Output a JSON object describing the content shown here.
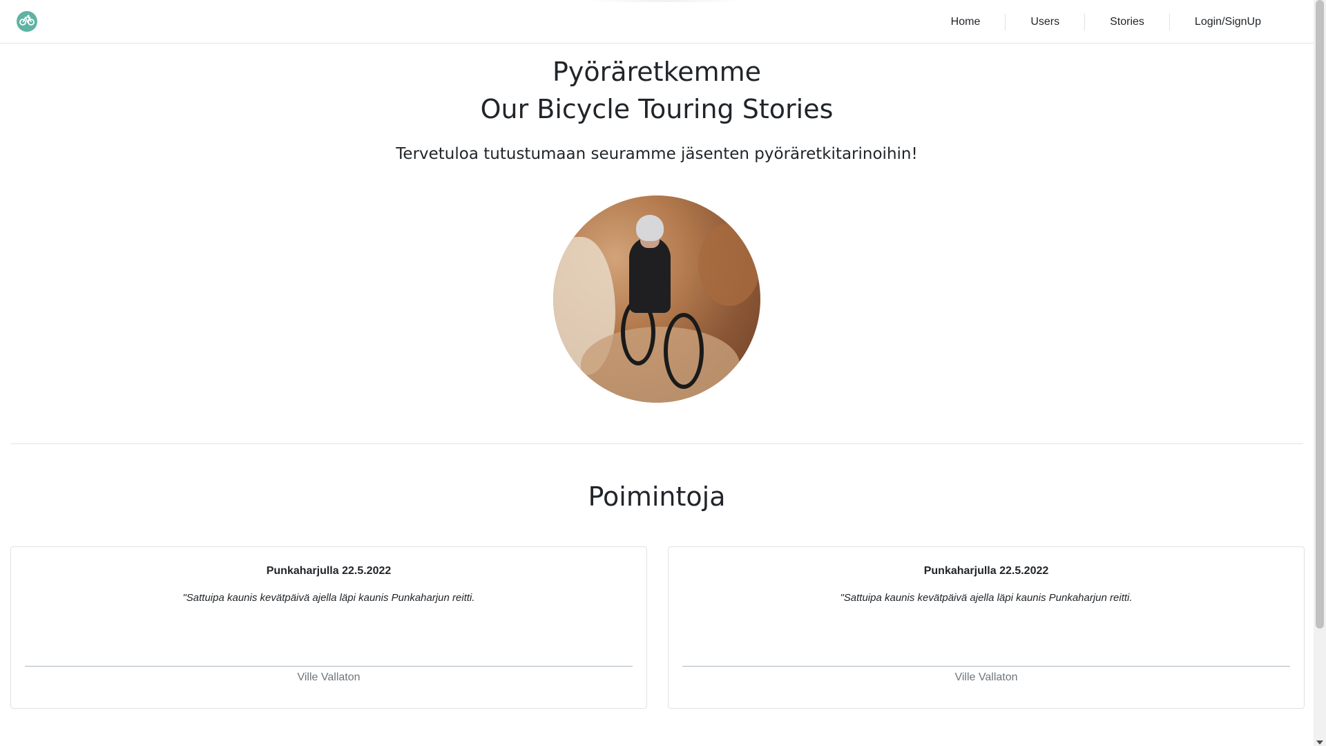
{
  "nav": {
    "logo_icon": "bicycle-icon",
    "links": [
      "Home",
      "Users",
      "Stories",
      "Login/SignUp"
    ]
  },
  "hero": {
    "title_line1": "Pyöräretkemme",
    "title_line2": "Our Bicycle Touring Stories",
    "subtitle": "Tervetuloa tutustumaan seuramme jäsenten pyöräretkitarinoihin!",
    "image_alt": "mountain biker riding on rocky desert trail"
  },
  "highlights": {
    "title": "Poimintoja",
    "cards": [
      {
        "title": "Punkaharjulla 22.5.2022",
        "quote": "\"Sattuipa kaunis kevätpäivä ajella läpi kaunis Punkaharjun reitti.",
        "author": "Ville Vallaton"
      },
      {
        "title": "Punkaharjulla 22.5.2022",
        "quote": "\"Sattuipa kaunis kevätpäivä ajella läpi kaunis Punkaharjun reitti.",
        "author": "Ville Vallaton"
      }
    ]
  },
  "colors": {
    "logo_bg": "#5fb3a3",
    "text": "#212529",
    "muted": "#6c757d",
    "border": "#dee2e6"
  }
}
